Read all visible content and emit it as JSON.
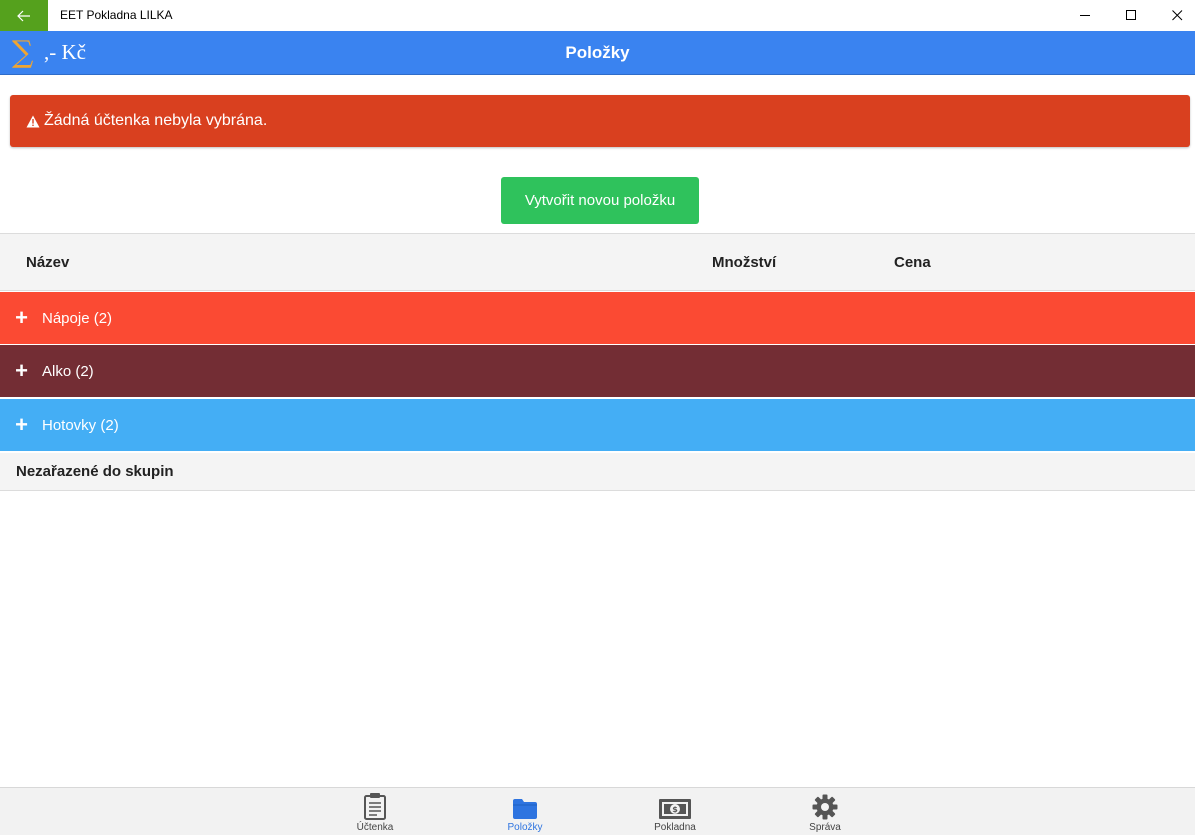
{
  "window": {
    "title": "EET Pokladna LILKA",
    "controls": [
      "minimize-icon",
      "maximize-icon",
      "close-icon"
    ]
  },
  "appbar": {
    "sum_symbol": "∑",
    "sum_text": ",- Kč",
    "title": "Položky",
    "color": "#3a83f0"
  },
  "alert": {
    "icon": "warning-icon",
    "text": "Žádná účtenka nebyla vybrána.",
    "color": "#d9401f"
  },
  "actions": {
    "create_label": "Vytvořit novou položku",
    "color": "#2fc25c"
  },
  "table": {
    "columns": {
      "name": "Název",
      "quantity": "Množství",
      "price": "Cena"
    },
    "groups": [
      {
        "label": "Nápoje (2)",
        "color": "#fb4a33",
        "text_color": "#ffffff"
      },
      {
        "label": "Alko (2)",
        "color": "#732d34",
        "text_color": "#ffffff"
      },
      {
        "label": "Hotovky (2)",
        "color": "#44aef5",
        "text_color": "#ffffff"
      }
    ],
    "ungrouped_label": "Nezařazené do skupin"
  },
  "bottom_nav": {
    "items": [
      {
        "label": "Účtenka",
        "icon": "clipboard-icon",
        "active": false
      },
      {
        "label": "Položky",
        "icon": "folder-icon",
        "active": true
      },
      {
        "label": "Pokladna",
        "icon": "cash-icon",
        "active": false
      },
      {
        "label": "Správa",
        "icon": "gear-icon",
        "active": false
      }
    ],
    "active_color": "#2e74e0"
  }
}
